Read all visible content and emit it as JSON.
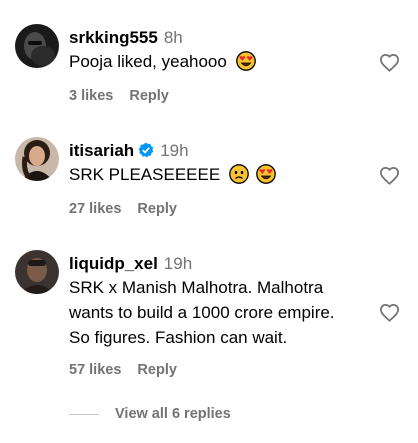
{
  "comments": [
    {
      "username": "srkking555",
      "time": "8h",
      "verified": false,
      "lines": [
        "Pooja liked, yeahooo"
      ],
      "emojis": [
        "heart-eyes-emoji"
      ],
      "likes": "3 likes",
      "reply": "Reply"
    },
    {
      "username": "itisariah",
      "time": "19h",
      "verified": true,
      "lines": [
        "SRK PLEASEEEEE"
      ],
      "emojis": [
        "sad-face-emoji",
        "heart-eyes-emoji"
      ],
      "likes": "27 likes",
      "reply": "Reply"
    },
    {
      "username": "liquidp_xel",
      "time": "19h",
      "verified": false,
      "lines": [
        "SRK x Manish Malhotra. Malhotra",
        "wants to build a 1000 crore empire.",
        "So figures. Fashion can wait."
      ],
      "emojis": [],
      "likes": "57 likes",
      "reply": "Reply"
    }
  ],
  "view_replies": "View all 6 replies",
  "colors": {
    "secondary_text": "#737373",
    "verified_blue": "#0095f6",
    "divider": "#c7c7c7"
  },
  "icons": [
    "heart-outline-icon",
    "verified-badge-icon"
  ]
}
